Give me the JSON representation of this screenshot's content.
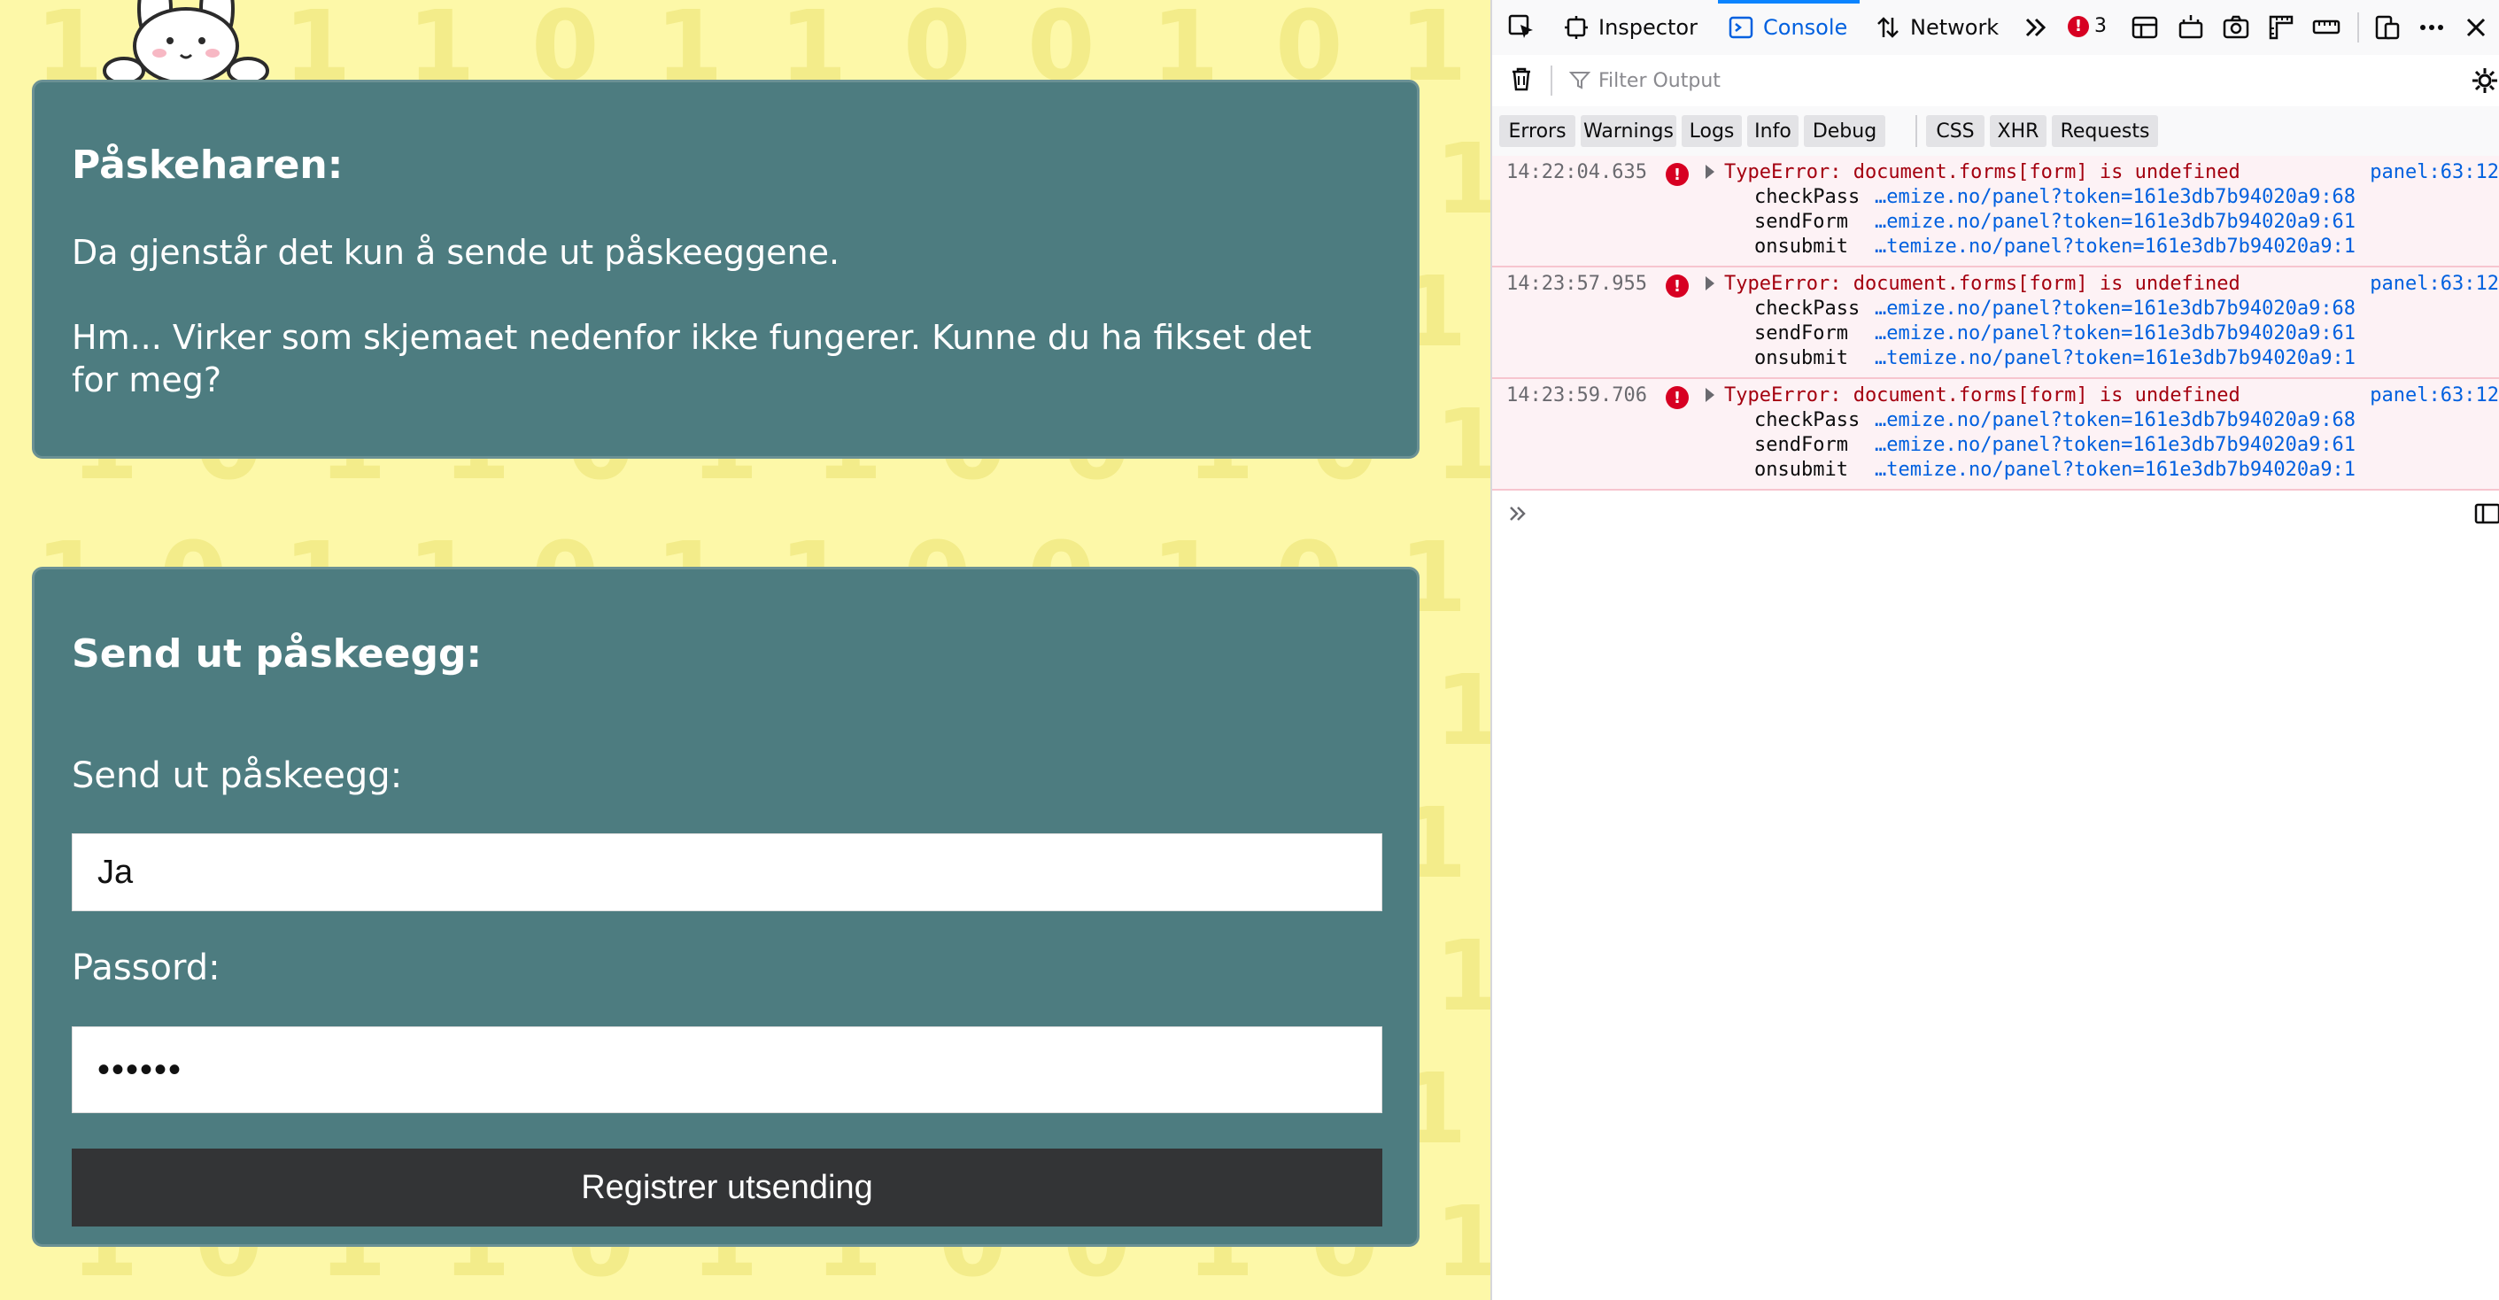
{
  "page": {
    "background_digits": [
      "1",
      "0",
      "1",
      "1",
      "0",
      "1",
      "1",
      "0",
      "0",
      "1",
      "0",
      "1"
    ],
    "intro": {
      "heading": "Påskeharen:",
      "paragraph1": "Da gjenstår det kun å sende ut påskeeggene.",
      "paragraph2": "Hm... Virker som skjemaet nedenfor ikke fungerer. Kunne du ha fikset det for meg?"
    },
    "form": {
      "heading": "Send ut påskeegg:",
      "send_label": "Send ut påskeegg:",
      "send_value": "Ja",
      "password_label": "Passord:",
      "password_value": "••••••",
      "submit_label": "Registrer utsending"
    },
    "colors": {
      "page_bg": "#fdf8a8",
      "panel_bg": "#4d7c80",
      "button_bg": "#333436"
    }
  },
  "devtools": {
    "tabs": {
      "inspector": "Inspector",
      "console": "Console",
      "network": "Network"
    },
    "error_count": "3",
    "filter_placeholder": "Filter Output",
    "levels": [
      "Errors",
      "Warnings",
      "Logs",
      "Info",
      "Debug"
    ],
    "categories": [
      "CSS",
      "XHR",
      "Requests"
    ],
    "logs": [
      {
        "time": "14:22:04.635",
        "message": "TypeError: document.forms[form] is undefined",
        "source": "panel:63:12",
        "trace": [
          {
            "fn": "checkPass",
            "loc": "…emize.no/panel?token=161e3db7b94020a9:68"
          },
          {
            "fn": "sendForm",
            "loc": "…emize.no/panel?token=161e3db7b94020a9:61"
          },
          {
            "fn": "onsubmit",
            "loc": "…temize.no/panel?token=161e3db7b94020a9:1"
          }
        ]
      },
      {
        "time": "14:23:57.955",
        "message": "TypeError: document.forms[form] is undefined",
        "source": "panel:63:12",
        "trace": [
          {
            "fn": "checkPass",
            "loc": "…emize.no/panel?token=161e3db7b94020a9:68"
          },
          {
            "fn": "sendForm",
            "loc": "…emize.no/panel?token=161e3db7b94020a9:61"
          },
          {
            "fn": "onsubmit",
            "loc": "…temize.no/panel?token=161e3db7b94020a9:1"
          }
        ]
      },
      {
        "time": "14:23:59.706",
        "message": "TypeError: document.forms[form] is undefined",
        "source": "panel:63:12",
        "trace": [
          {
            "fn": "checkPass",
            "loc": "…emize.no/panel?token=161e3db7b94020a9:68"
          },
          {
            "fn": "sendForm",
            "loc": "…emize.no/panel?token=161e3db7b94020a9:61"
          },
          {
            "fn": "onsubmit",
            "loc": "…temize.no/panel?token=161e3db7b94020a9:1"
          }
        ]
      }
    ],
    "colors": {
      "error_red": "#d70022",
      "error_text": "#a4000f",
      "link_blue": "#0060df",
      "accent": "#0a84ff"
    }
  }
}
